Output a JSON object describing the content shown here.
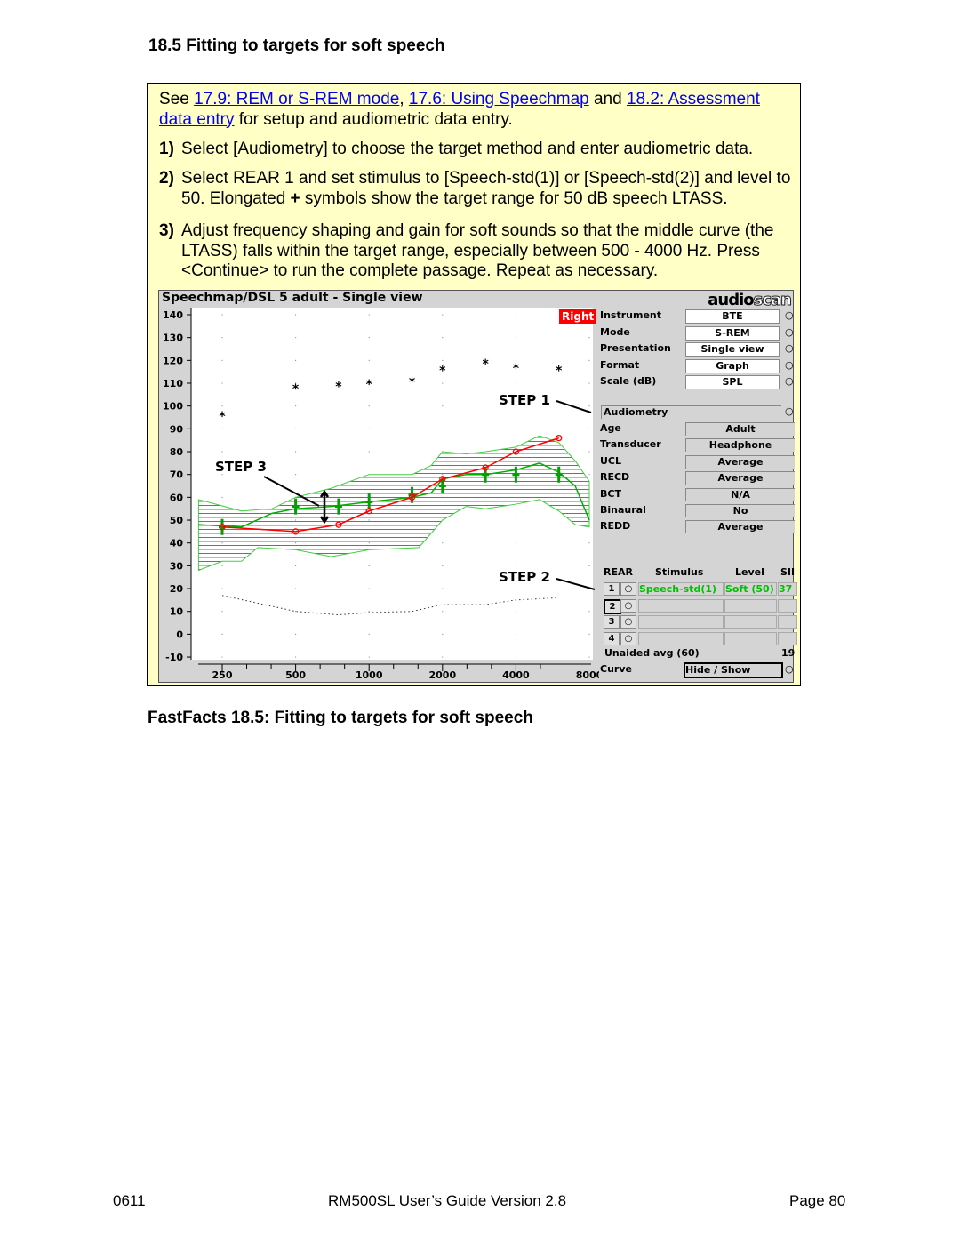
{
  "section_heading": "18.5  Fitting to targets for soft speech",
  "intro": {
    "see": "See",
    "link1": "17.9: REM or S-REM mode",
    "comma": ",",
    "link2": "17.6: Using Speechmap",
    "and": "and",
    "link3": "18.2: Assessment data entry",
    "rest": "for setup and audiometric data entry."
  },
  "steps": [
    {
      "num": "1)",
      "text": "Select [Audiometry] to choose the target method and enter audiometric data."
    },
    {
      "num": "2)",
      "text_a": "Select REAR 1 and set stimulus to [Speech-std(1)] or [Speech-std(2)] and level to 50. Elongated ",
      "plus": "+",
      "text_b": " symbols show the target range for 50 dB speech LTASS."
    },
    {
      "num": "3)",
      "text": "Adjust frequency shaping and gain for soft sounds so that the middle curve (the LTASS) falls within the target range, especially between 500 - 4000 Hz. Press <Continue> to run the complete passage. Repeat as necessary."
    }
  ],
  "screenshot": {
    "title": "Speechmap/DSL 5 adult - Single view",
    "logo": "audioscan",
    "ear_badge": "Right",
    "annotations": {
      "step1": "STEP 1",
      "step2": "STEP 2",
      "step3": "STEP 3"
    },
    "settings": [
      {
        "label": "Instrument",
        "value": "BTE"
      },
      {
        "label": "Mode",
        "value": "S-REM"
      },
      {
        "label": "Presentation",
        "value": "Single view"
      },
      {
        "label": "Format",
        "value": "Graph"
      },
      {
        "label": "Scale (dB)",
        "value": "SPL"
      }
    ],
    "audiometry_button": "Audiometry",
    "audiometry": [
      {
        "label": "Age",
        "value": "Adult"
      },
      {
        "label": "Transducer",
        "value": "Headphone"
      },
      {
        "label": "UCL",
        "value": "Average"
      },
      {
        "label": "RECD",
        "value": "Average"
      },
      {
        "label": "BCT",
        "value": "N/A"
      },
      {
        "label": "Binaural",
        "value": "No"
      },
      {
        "label": "REDD",
        "value": "Average"
      }
    ],
    "rear_headers": {
      "rear": "REAR",
      "stimulus": "Stimulus",
      "level": "Level",
      "sii": "SII"
    },
    "rear_rows": [
      {
        "num": "1",
        "stimulus": "Speech-std(1)",
        "level": "Soft (50)",
        "sii": "37"
      },
      {
        "num": "2",
        "stimulus": "",
        "level": "",
        "sii": ""
      },
      {
        "num": "3",
        "stimulus": "",
        "level": "",
        "sii": ""
      },
      {
        "num": "4",
        "stimulus": "",
        "level": "",
        "sii": ""
      }
    ],
    "unaided_label": "Unaided avg (60)",
    "unaided_sii": "19",
    "curve_label": "Curve",
    "curve_button": "Hide / Show",
    "colors": {
      "aided": "#ff0000",
      "speech_range": "#00c000",
      "badge": "#ff0000"
    }
  },
  "chart_data": {
    "type": "line",
    "x_scale": "log",
    "xlim": [
      200,
      8000
    ],
    "ylim": [
      -10,
      140
    ],
    "x_ticks": [
      "250",
      "500",
      "1000",
      "2000",
      "4000",
      "8000"
    ],
    "y_ticks": [
      "140",
      "130",
      "120",
      "110",
      "100",
      "90",
      "80",
      "70",
      "60",
      "50",
      "40",
      "30",
      "20",
      "10",
      "0",
      "-10"
    ],
    "ucl": {
      "x": [
        250,
        500,
        750,
        1000,
        1500,
        2000,
        3000,
        4000,
        6000
      ],
      "y": [
        96,
        108,
        109,
        110,
        111,
        116,
        119,
        117,
        116
      ]
    },
    "aided_ltass": {
      "x": [
        250,
        500,
        750,
        1000,
        1500,
        2000,
        3000,
        4000,
        6000
      ],
      "y": [
        47,
        45,
        48,
        54,
        60,
        68,
        73,
        80,
        86
      ]
    },
    "targets": {
      "x": [
        250,
        500,
        750,
        1000,
        1500,
        2000,
        3000,
        4000,
        6000
      ],
      "y": [
        47,
        56,
        56,
        58,
        61,
        65,
        70,
        70,
        70
      ]
    },
    "speech_upper": {
      "x": [
        200,
        300,
        400,
        500,
        700,
        1000,
        1500,
        1800,
        2000,
        2500,
        3000,
        4000,
        5000,
        6000,
        7000,
        8000
      ],
      "y": [
        59,
        54,
        55,
        60,
        64,
        70,
        70,
        74,
        80,
        79,
        80,
        82,
        87,
        84,
        76,
        67
      ]
    },
    "speech_middle": {
      "x": [
        200,
        300,
        400,
        500,
        700,
        1000,
        1500,
        1800,
        2000,
        2500,
        3000,
        4000,
        5000,
        6000,
        7000,
        8000
      ],
      "y": [
        48,
        47,
        53,
        55,
        56,
        58,
        60,
        62,
        68,
        70,
        70,
        72,
        75,
        71,
        65,
        50
      ]
    },
    "speech_lower": {
      "x": [
        200,
        250,
        300,
        350,
        500,
        700,
        1000,
        1600,
        2000,
        2500,
        3000,
        4000,
        5000,
        6000,
        7000,
        8000
      ],
      "y": [
        28,
        32,
        32,
        38,
        37,
        34,
        37,
        38,
        50,
        56,
        55,
        57,
        59,
        54,
        48,
        47
      ]
    },
    "threshold": {
      "x": [
        250,
        500,
        750,
        1000,
        1500,
        2000,
        3000,
        4000,
        6000
      ],
      "y": [
        17,
        10,
        8.5,
        9.5,
        10,
        13,
        13,
        15,
        16
      ]
    }
  },
  "caption": "FastFacts 18.5: Fitting to targets for soft speech",
  "footer": {
    "left": "0611",
    "center": "RM500SL User’s Guide Version 2.8",
    "right": "Page 80"
  }
}
